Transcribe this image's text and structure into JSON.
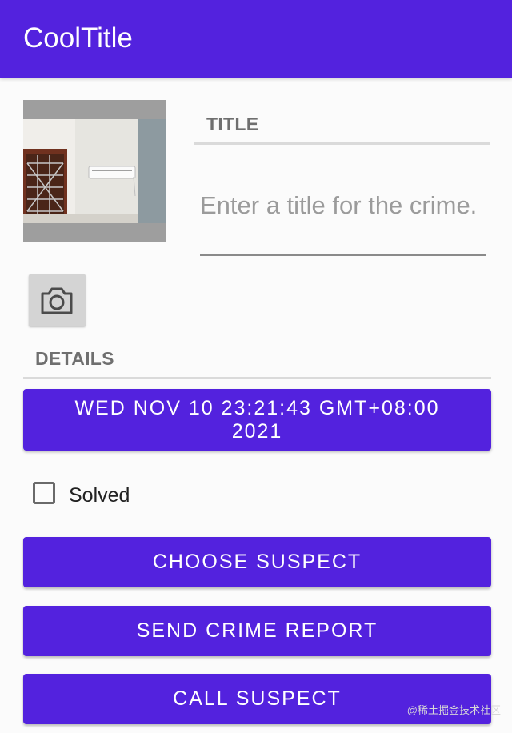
{
  "app_bar": {
    "title": "CoolTitle",
    "color": "#5322de"
  },
  "photo": {
    "icon": "crime-photo-thumbnail"
  },
  "camera_button": {
    "icon": "camera-icon"
  },
  "title_section": {
    "label": "TITLE",
    "placeholder": "Enter a title for the crime.",
    "value": ""
  },
  "details_section": {
    "label": "DETAILS",
    "date_button_label": "WED NOV 10 23:21:43 GMT+08:00 2021",
    "solved": {
      "label": "Solved",
      "checked": false
    }
  },
  "buttons": {
    "choose_suspect": "CHOOSE SUSPECT",
    "send_report": "SEND CRIME REPORT",
    "call_suspect": "CALL SUSPECT"
  },
  "watermark": "@稀土掘金技术社区"
}
